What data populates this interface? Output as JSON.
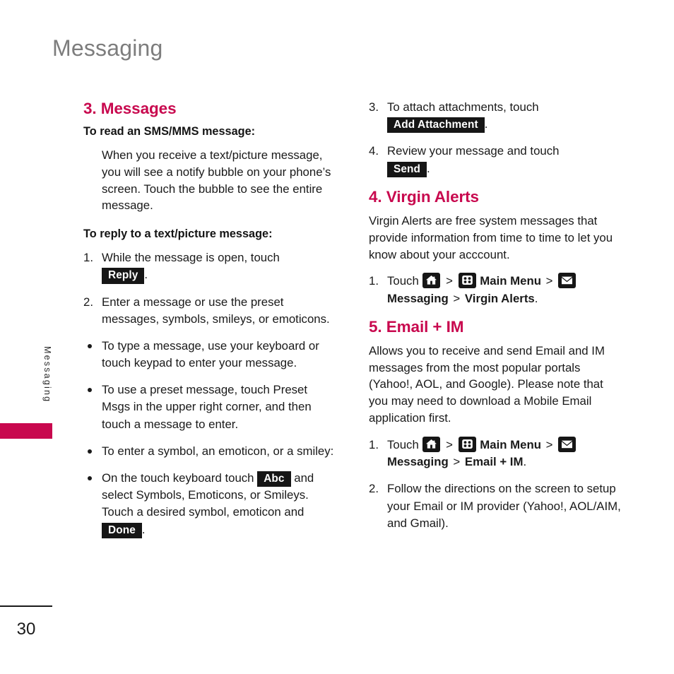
{
  "page": {
    "title": "Messaging",
    "side_tab_label": "Messaging",
    "page_number": "30",
    "accent_color": "#c8084e",
    "title_color": "#7d7d7d",
    "badge_color": "#161616"
  },
  "icons": {
    "home": "home-icon",
    "grid": "main-menu-grid-icon",
    "mail": "envelope-icon"
  },
  "left_column": {
    "section_heading": "3. Messages",
    "sub_heading_read": "To read an SMS/MMS message:",
    "read_paragraph": "When you receive a text/picture message, you will see a notify bubble on your phone’s screen. Touch the bubble to see the entire message.",
    "sub_heading_reply": "To reply to a text/picture message:",
    "step1_marker": "1.",
    "step1_text_before": "While the message is open, touch",
    "step1_key": "Reply",
    "step1_text_after": ".",
    "step2_marker": "2.",
    "step2_text": "Enter a message or use the preset messages, symbols, smileys, or emoticons.",
    "bullets": [
      {
        "text": "To type a message, use your keyboard or touch keypad to enter your message."
      },
      {
        "text": "To use a preset message, touch Preset Msgs in the upper right corner, and then touch a message to enter."
      },
      {
        "text": "To enter a symbol, an emoticon, or a smiley:"
      }
    ],
    "last_bullet": {
      "text_before": "On the touch keyboard touch",
      "key1": "Abc",
      "text_middle": "and select Symbols, Emoticons, or Smileys. Touch a desired symbol, emoticon and",
      "key2": "Done",
      "text_after": "."
    }
  },
  "right_column": {
    "step3_marker": "3.",
    "step3_text_before": "To attach attachments, touch",
    "step3_key": "Add Attachment",
    "step3_text_after": ".",
    "step4_marker": "4.",
    "step4_text_before": "Review your message and touch",
    "step4_key": "Send",
    "step4_text_after": ".",
    "virgin_alerts": {
      "heading": "4. Virgin Alerts",
      "paragraph": "Virgin Alerts are free system messages that provide information from time to time to let you know about your acccount.",
      "step1_marker": "1.",
      "touch_label": "Touch",
      "sep": ">",
      "main_menu_label": "Main Menu",
      "messaging_label": "Messaging",
      "target_label": "Virgin Alerts",
      "period": "."
    },
    "email_im": {
      "heading": "5. Email + IM",
      "paragraph": "Allows you to receive and send Email and IM messages from the most popular portals (Yahoo!, AOL, and Google). Please note that you may need to download a Mobile Email application first.",
      "step1_marker": "1.",
      "touch_label": "Touch",
      "sep": ">",
      "main_menu_label": "Main Menu",
      "messaging_label": "Messaging",
      "target_label": "Email + IM",
      "period": ".",
      "step2_marker": "2.",
      "step2_text": "Follow the directions on the screen to setup your Email or IM provider (Yahoo!, AOL/AIM, and Gmail)."
    }
  }
}
